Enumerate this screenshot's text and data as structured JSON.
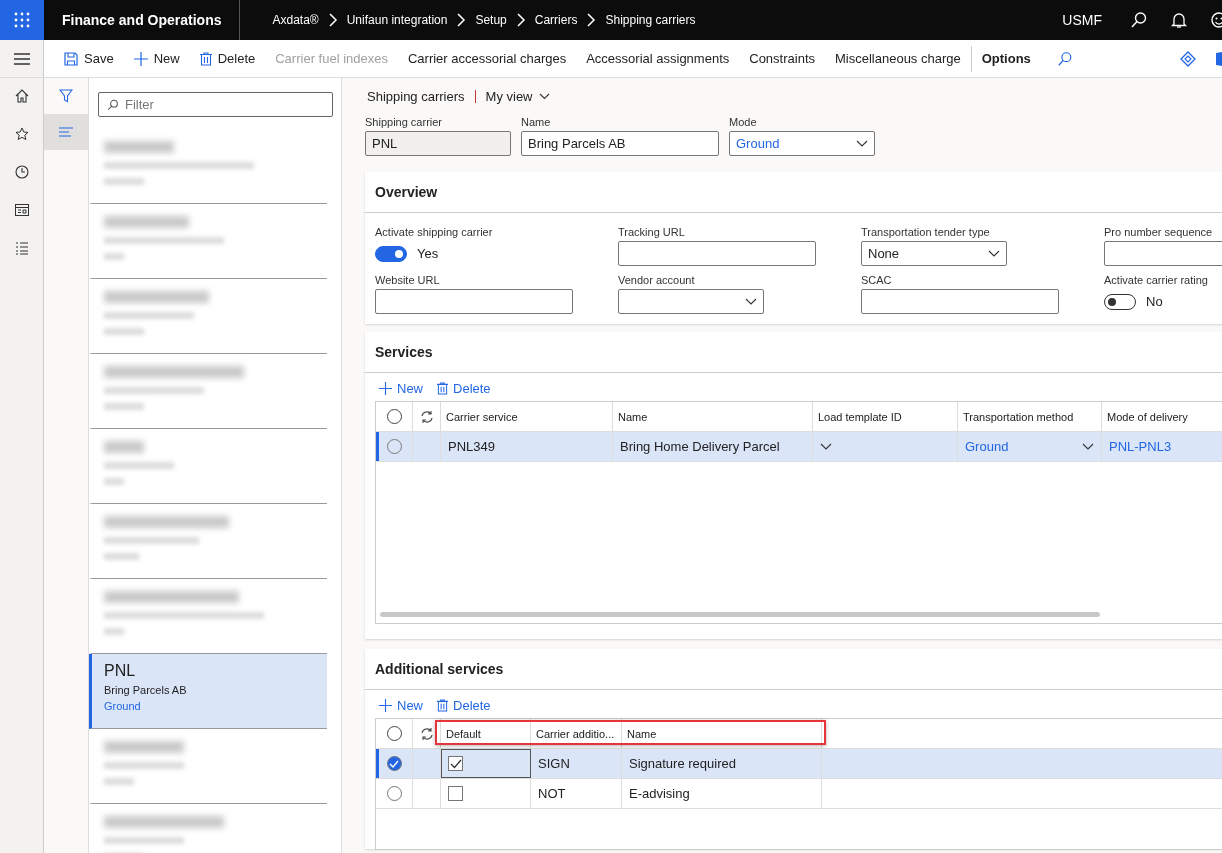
{
  "app": {
    "title": "Finance and Operations"
  },
  "breadcrumb": [
    "Axdata®",
    "Unifaun integration",
    "Setup",
    "Carriers",
    "Shipping carriers"
  ],
  "company": "USMF",
  "action_pane": {
    "file_actions": [
      {
        "label": "Save"
      },
      {
        "label": "New"
      },
      {
        "label": "Delete"
      }
    ],
    "commands": [
      {
        "label": "Carrier fuel indexes",
        "disabled": true
      },
      {
        "label": "Carrier accessorial charges",
        "disabled": false
      },
      {
        "label": "Accessorial assignments",
        "disabled": false
      },
      {
        "label": "Constraints",
        "disabled": false
      },
      {
        "label": "Miscellaneous charge",
        "disabled": false
      }
    ],
    "tab": "Options"
  },
  "filter_rail": [
    {
      "selected": false
    },
    {
      "selected": true
    }
  ],
  "list": {
    "filter_placeholder": "Filter",
    "items": [
      {
        "kind": "blurred",
        "selected": false
      },
      {
        "kind": "blurred",
        "selected": false
      },
      {
        "kind": "blurred",
        "selected": false
      },
      {
        "kind": "blurred",
        "selected": false
      },
      {
        "kind": "blurred",
        "selected": false
      },
      {
        "kind": "blurred",
        "selected": false
      },
      {
        "kind": "blurred",
        "selected": false
      },
      {
        "kind": "record",
        "selected": true,
        "title": "PNL",
        "subtitle": "Bring Parcels AB",
        "mode": "Ground"
      },
      {
        "kind": "blurred",
        "selected": false
      },
      {
        "kind": "blurred",
        "selected": false
      }
    ]
  },
  "page": {
    "title": "Shipping carriers",
    "view": "My view",
    "header_fields": [
      {
        "kind": "readonly",
        "label": "Shipping carrier",
        "value": "PNL"
      },
      {
        "kind": "input",
        "label": "Name",
        "value": "Bring Parcels AB"
      },
      {
        "kind": "dropdown",
        "label": "Mode",
        "value": "Ground"
      }
    ]
  },
  "overview": {
    "title": "Overview",
    "fields": [
      {
        "kind": "toggle",
        "label": "Activate shipping carrier",
        "on": true,
        "value": "Yes"
      },
      {
        "kind": "input",
        "label": "Tracking URL"
      },
      {
        "kind": "dropdown",
        "label": "Transportation tender type",
        "value": "None"
      },
      {
        "kind": "input",
        "label": "Pro number sequence"
      },
      {
        "kind": "input",
        "label": "Website URL"
      },
      {
        "kind": "dropdown",
        "label": "Vendor account"
      },
      {
        "kind": "input",
        "label": "SCAC"
      },
      {
        "kind": "toggle",
        "label": "Activate carrier rating",
        "on": false,
        "value": "No"
      }
    ]
  },
  "services": {
    "title": "Services",
    "toolbar": [
      "New",
      "Delete"
    ],
    "all_selected": false,
    "columns": [
      "Carrier service",
      "Name",
      "Load template ID",
      "Transportation method",
      "Mode of delivery"
    ],
    "rows": [
      {
        "selected": false,
        "current": true,
        "cells": [
          {
            "kind": "text",
            "value": "PNL349"
          },
          {
            "kind": "text",
            "value": "Bring Home Delivery Parcel"
          },
          {
            "kind": "dropdown"
          },
          {
            "kind": "dropdown",
            "value": "Ground"
          },
          {
            "kind": "link",
            "value": "PNL-PNL3"
          }
        ]
      }
    ]
  },
  "additional_services": {
    "title": "Additional services",
    "toolbar": [
      "New",
      "Delete"
    ],
    "all_selected": false,
    "columns": [
      {
        "label": "Default",
        "highlighted": true
      },
      {
        "label": "Carrier additio...",
        "highlighted": true
      },
      {
        "label": "Name",
        "highlighted": true
      }
    ],
    "rows": [
      {
        "selected": true,
        "current": true,
        "default": true,
        "code": "SIGN",
        "name": "Signature required"
      },
      {
        "selected": false,
        "current": false,
        "default": false,
        "code": "NOT",
        "name": "E-advising"
      }
    ]
  }
}
